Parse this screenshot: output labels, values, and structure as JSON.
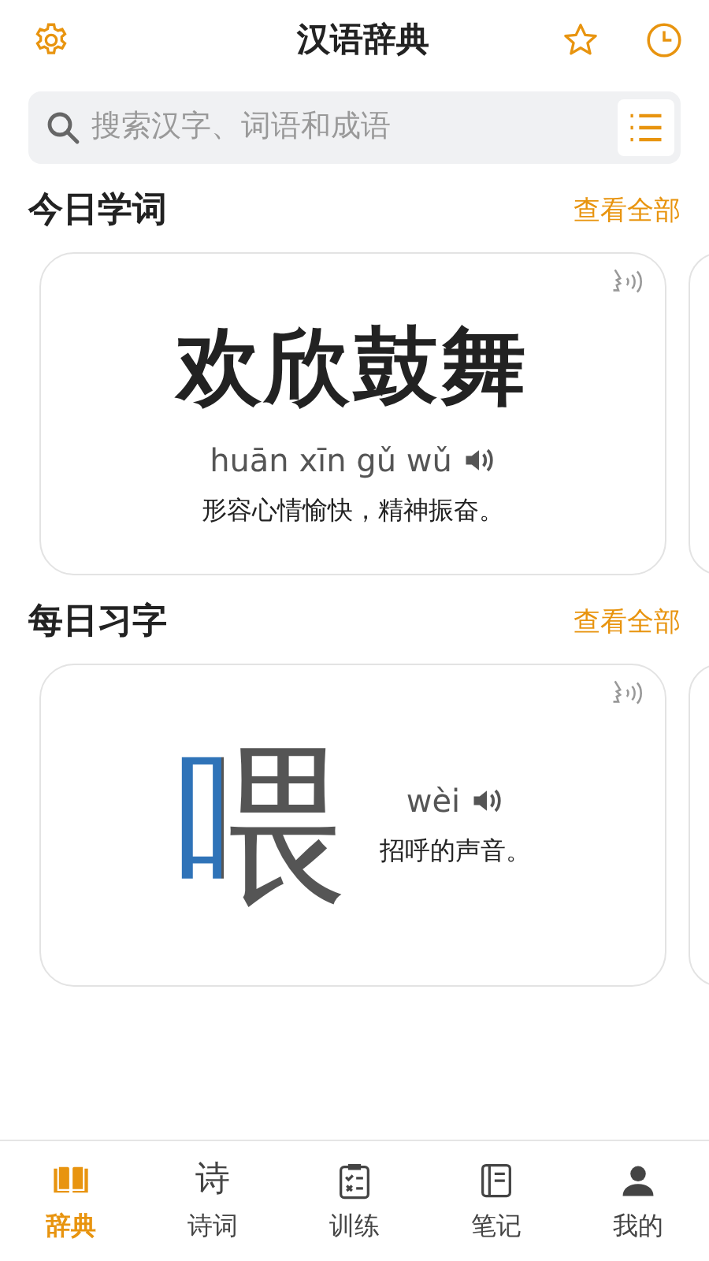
{
  "header": {
    "title": "汉语辞典"
  },
  "search": {
    "placeholder": "搜索汉字、词语和成语"
  },
  "sections": [
    {
      "kind": "word",
      "title": "今日学词",
      "more": "查看全部",
      "card": {
        "word": "欢欣鼓舞",
        "pinyin": "huān xīn gǔ wǔ",
        "meaning": "形容心情愉快，精神振奋。"
      }
    },
    {
      "kind": "char",
      "title": "每日习字",
      "more": "查看全部",
      "card": {
        "word": "喂",
        "pinyin": "wèi",
        "meaning": "招呼的声音。"
      }
    }
  ],
  "tabs": [
    {
      "kind": "book",
      "label": "辞典",
      "selected": true
    },
    {
      "kind": "glyph",
      "glyph": "诗",
      "label": "诗词",
      "selected": false
    },
    {
      "kind": "checklist",
      "label": "训练",
      "selected": false
    },
    {
      "kind": "notebook",
      "label": "笔记",
      "selected": false
    },
    {
      "kind": "person",
      "label": "我的",
      "selected": false
    }
  ]
}
